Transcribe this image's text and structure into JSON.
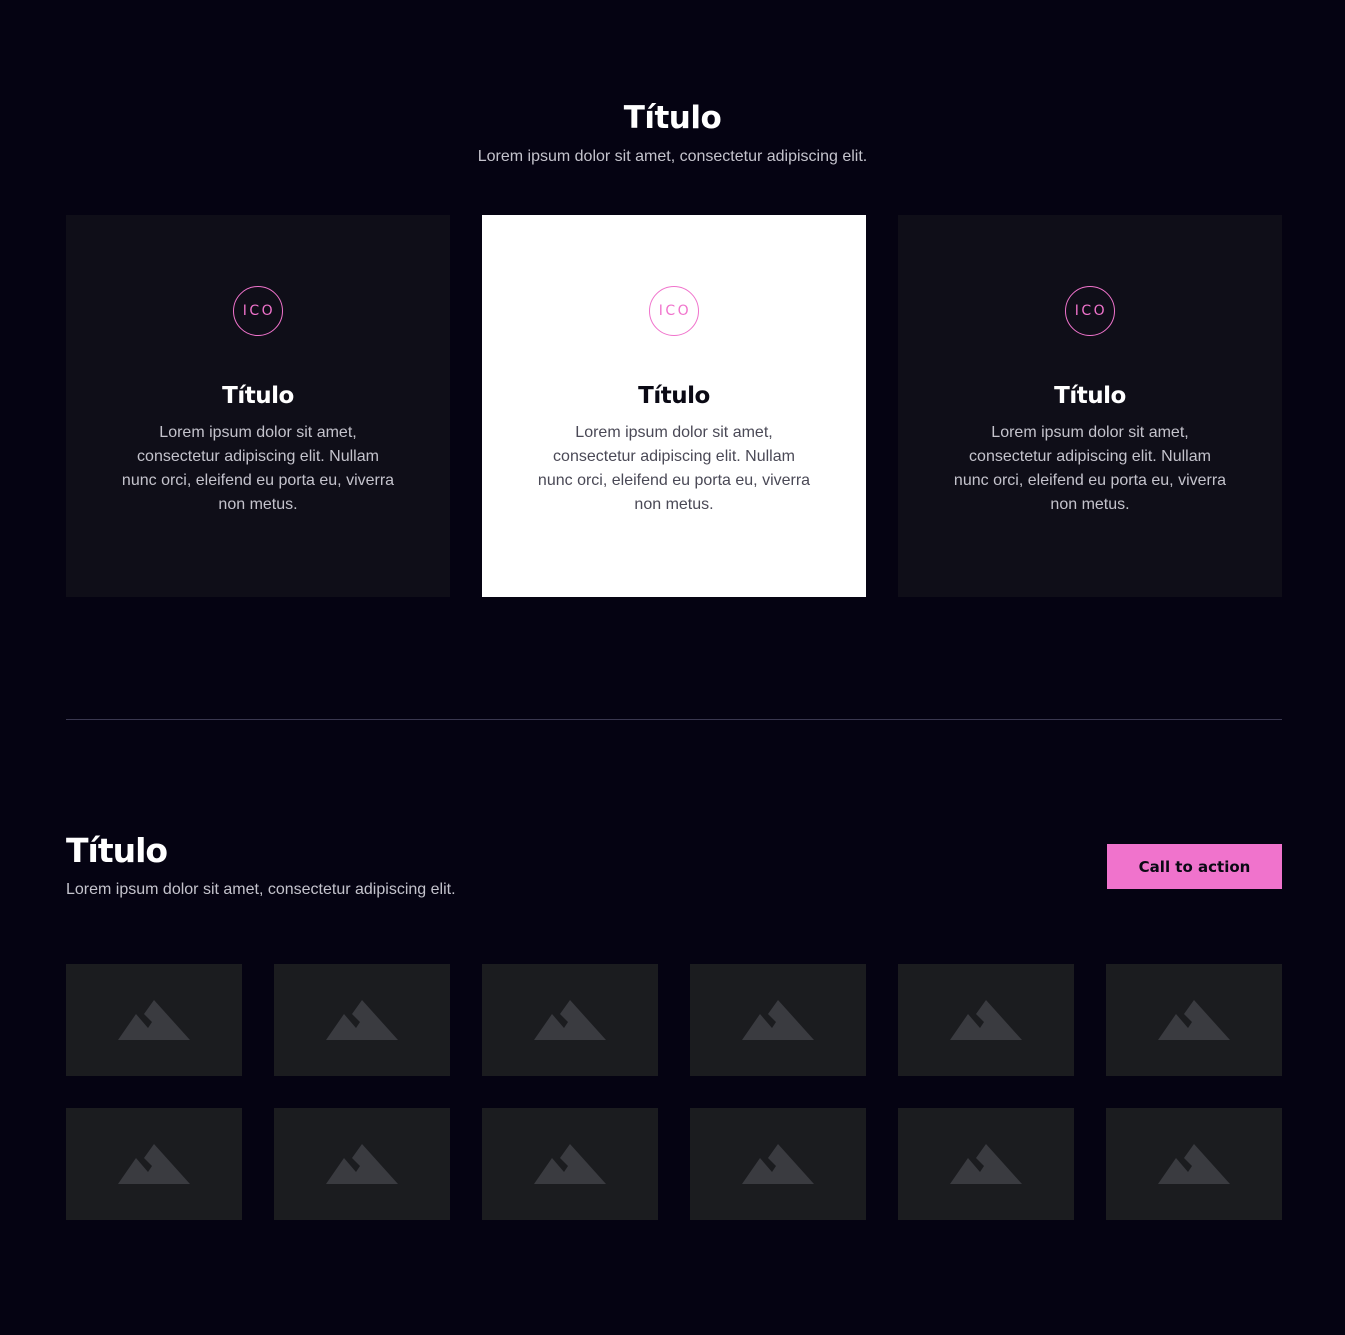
{
  "section1": {
    "title": "Título",
    "subtitle": "Lorem ipsum dolor sit amet, consectetur adipiscing elit.",
    "cards": [
      {
        "icon_label": "ICO",
        "title": "Título",
        "text": "Lorem ipsum dolor sit amet, consectetur adipiscing elit. Nullam nunc orci, eleifend eu porta eu, viverra non metus."
      },
      {
        "icon_label": "ICO",
        "title": "Título",
        "text": "Lorem ipsum dolor sit amet, consectetur adipiscing elit. Nullam nunc orci, eleifend eu porta eu, viverra non metus."
      },
      {
        "icon_label": "ICO",
        "title": "Título",
        "text": "Lorem ipsum dolor sit amet, consectetur adipiscing elit. Nullam nunc orci, eleifend eu porta eu, viverra non metus."
      }
    ]
  },
  "section2": {
    "title": "Título",
    "subtitle": "Lorem ipsum dolor sit amet, consectetur adipiscing elit.",
    "cta_label": "Call to action",
    "gallery_icon": "image-placeholder-icon",
    "gallery_count": 12
  },
  "colors": {
    "background": "#050312",
    "card_dark": "#0f0e18",
    "card_light": "#ffffff",
    "accent": "#f073cc",
    "placeholder": "#1b1c1f",
    "placeholder_icon": "#3a3b40"
  }
}
